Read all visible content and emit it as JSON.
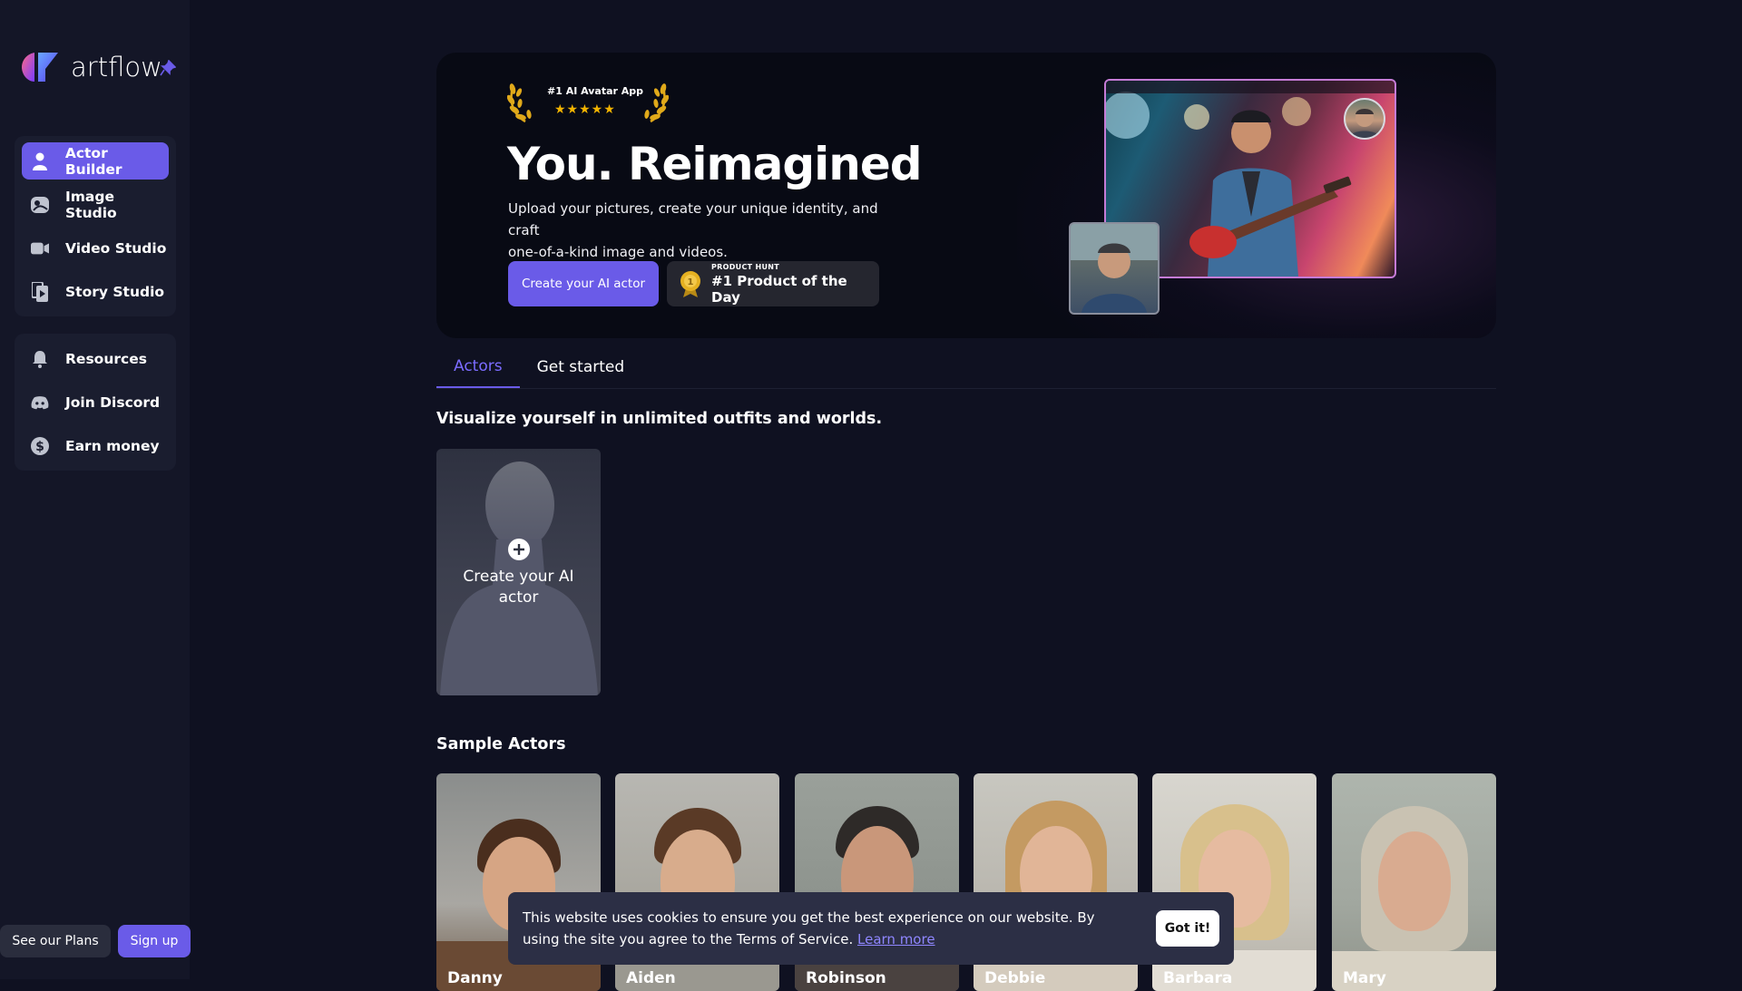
{
  "app": {
    "name": "artflow",
    "accent_color": "#6a5be8"
  },
  "sidebar": {
    "primary_items": [
      {
        "label": "Actor Builder",
        "icon": "person-icon",
        "active": true
      },
      {
        "label": "Image Studio",
        "icon": "image-studio-icon",
        "active": false
      },
      {
        "label": "Video Studio",
        "icon": "video-camera-icon",
        "active": false
      },
      {
        "label": "Story Studio",
        "icon": "story-icon",
        "active": false
      }
    ],
    "secondary_items": [
      {
        "label": "Resources",
        "icon": "bell-icon"
      },
      {
        "label": "Join Discord",
        "icon": "discord-icon"
      },
      {
        "label": "Earn money",
        "icon": "dollar-icon"
      }
    ],
    "see_plans_label": "See our Plans",
    "sign_up_label": "Sign up"
  },
  "hero": {
    "award_title": "#1 AI Avatar App",
    "award_stars": "★★★★★",
    "title": "You. Reimagined",
    "subtitle_line1": "Upload your pictures, create your unique identity, and craft",
    "subtitle_line2": " one-of-a-kind image and videos.",
    "cta_label": "Create your AI actor",
    "product_hunt_small": "PRODUCT HUNT",
    "product_hunt_big": "#1 Product of the Day"
  },
  "tabs": [
    {
      "label": "Actors",
      "active": true
    },
    {
      "label": "Get started",
      "active": false
    }
  ],
  "actors_section": {
    "heading": "Visualize yourself in unlimited outfits and worlds.",
    "create_card_label_line1": "Create your AI",
    "create_card_label_line2": "actor"
  },
  "sample_actors": {
    "heading": "Sample Actors",
    "actors": [
      {
        "name": "Danny"
      },
      {
        "name": "Aiden"
      },
      {
        "name": "Robinson"
      },
      {
        "name": "Debbie"
      },
      {
        "name": "Barbara"
      },
      {
        "name": "Mary"
      }
    ]
  },
  "cookie_banner": {
    "text": "This website uses cookies to ensure you get the best experience on our website. By using the site you agree to the Terms of Service.",
    "link_label": "Learn more",
    "button_label": "Got it!"
  }
}
